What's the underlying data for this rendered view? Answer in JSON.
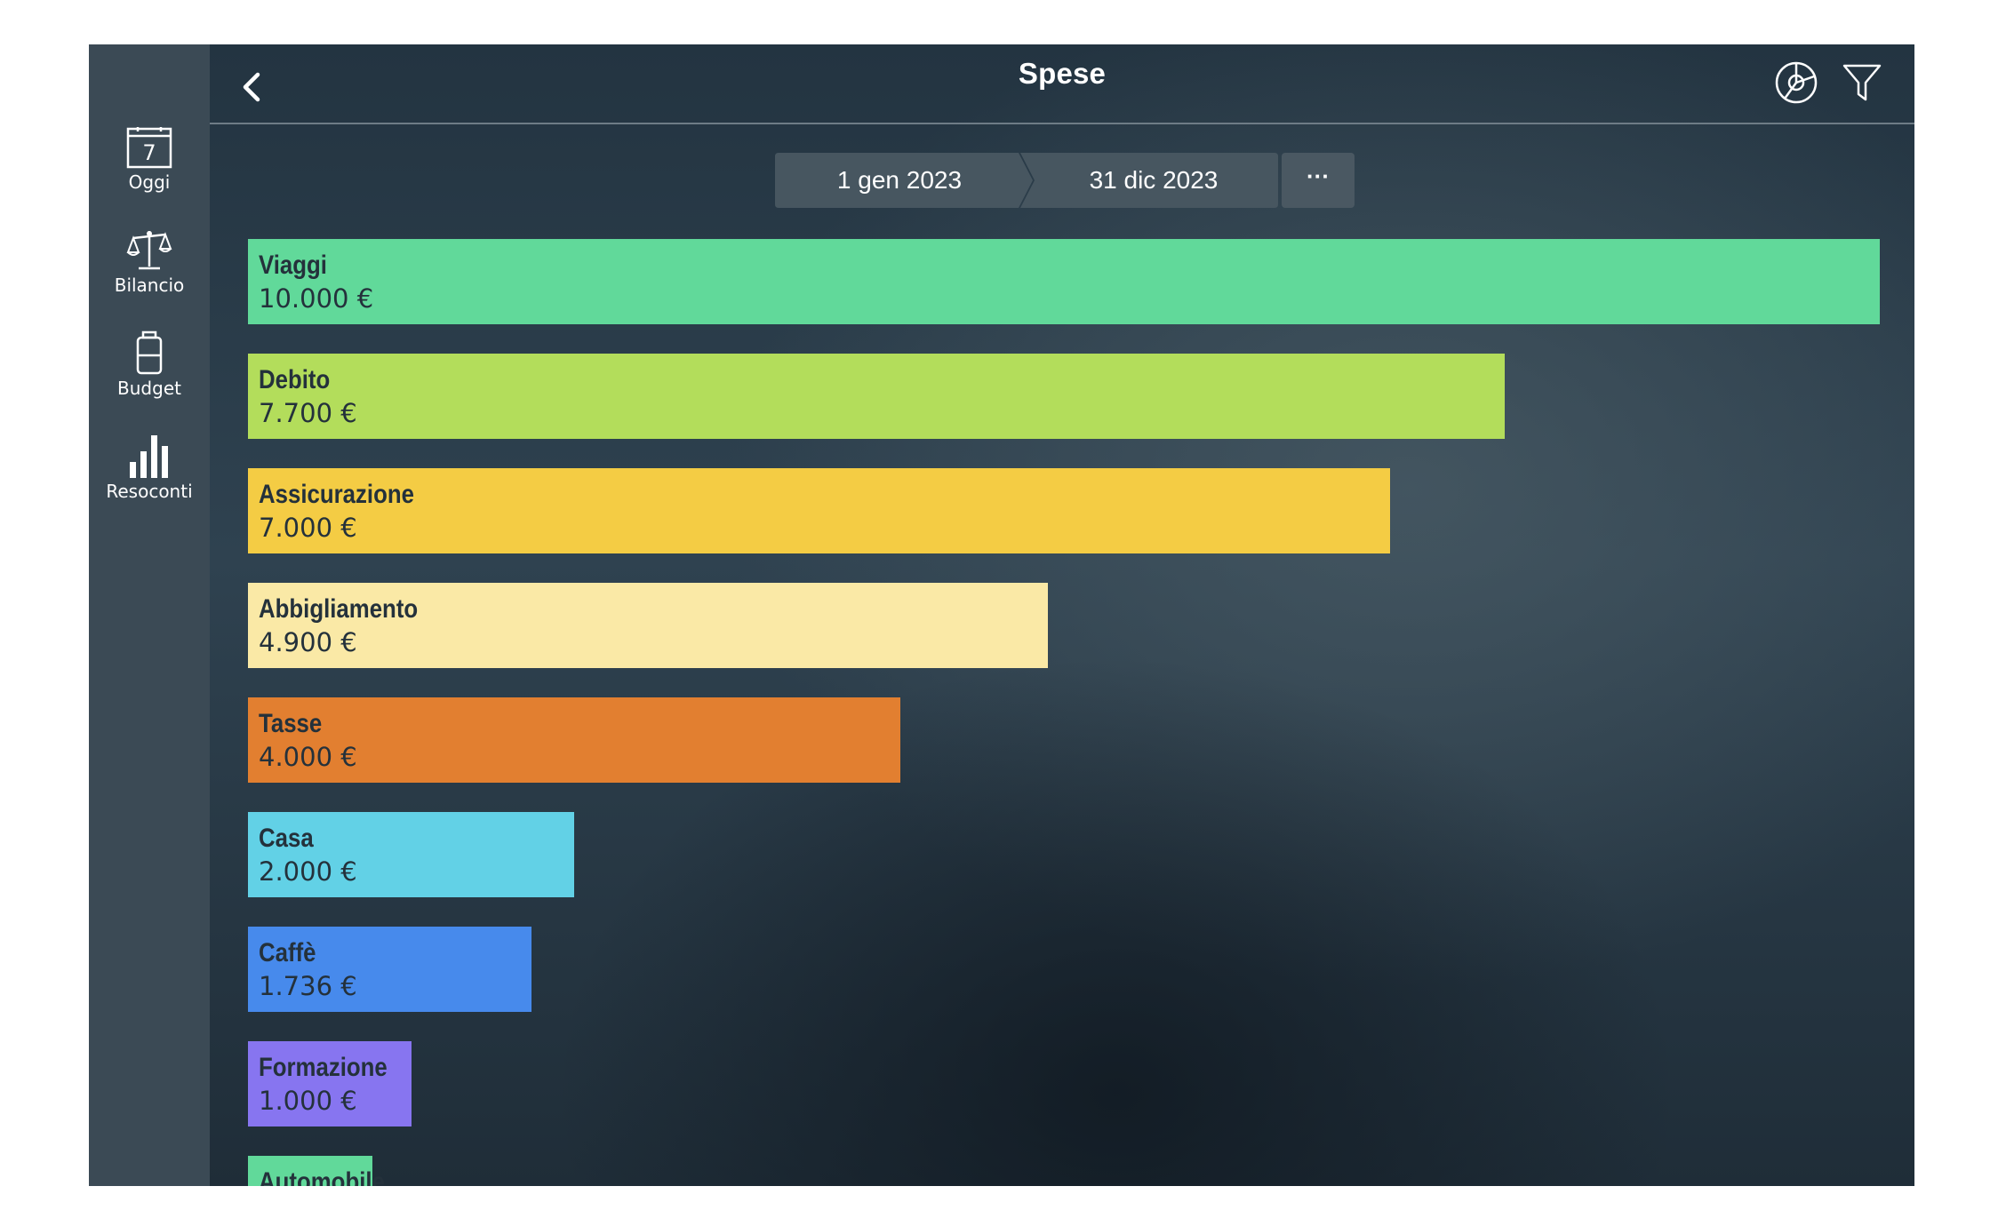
{
  "sidebar": {
    "items": [
      {
        "label": "Oggi",
        "icon": "calendar-icon",
        "calendar_day": "7"
      },
      {
        "label": "Bilancio",
        "icon": "scales-icon"
      },
      {
        "label": "Budget",
        "icon": "jar-icon"
      },
      {
        "label": "Resoconti",
        "icon": "bar-chart-icon",
        "active": true
      }
    ]
  },
  "header": {
    "title": "Spese",
    "back_icon": "chevron-left-icon",
    "chart_icon": "pie-chart-icon",
    "filter_icon": "funnel-icon"
  },
  "date_range": {
    "start": "1 gen 2023",
    "end": "31 dic 2023",
    "more": "···"
  },
  "chart_data": {
    "type": "bar",
    "orientation": "horizontal",
    "categories": [
      "Viaggi",
      "Debito",
      "Assicurazione",
      "Abbigliamento",
      "Tasse",
      "Casa",
      "Caffè",
      "Formazione",
      "Automobile"
    ],
    "values": [
      10000,
      7700,
      7000,
      4900,
      4000,
      2000,
      1736,
      1000,
      760
    ],
    "value_labels": [
      "10.000 €",
      "7.700 €",
      "7.000 €",
      "4.900 €",
      "4.000 €",
      "2.000 €",
      "1.736 €",
      "1.000 €",
      ""
    ],
    "colors": [
      "#61d99a",
      "#b3dd5b",
      "#f4cc44",
      "#fae9a6",
      "#e27f30",
      "#62d1e6",
      "#478aec",
      "#8775f0",
      "#61d99a"
    ],
    "xlim": [
      0,
      10000
    ]
  }
}
